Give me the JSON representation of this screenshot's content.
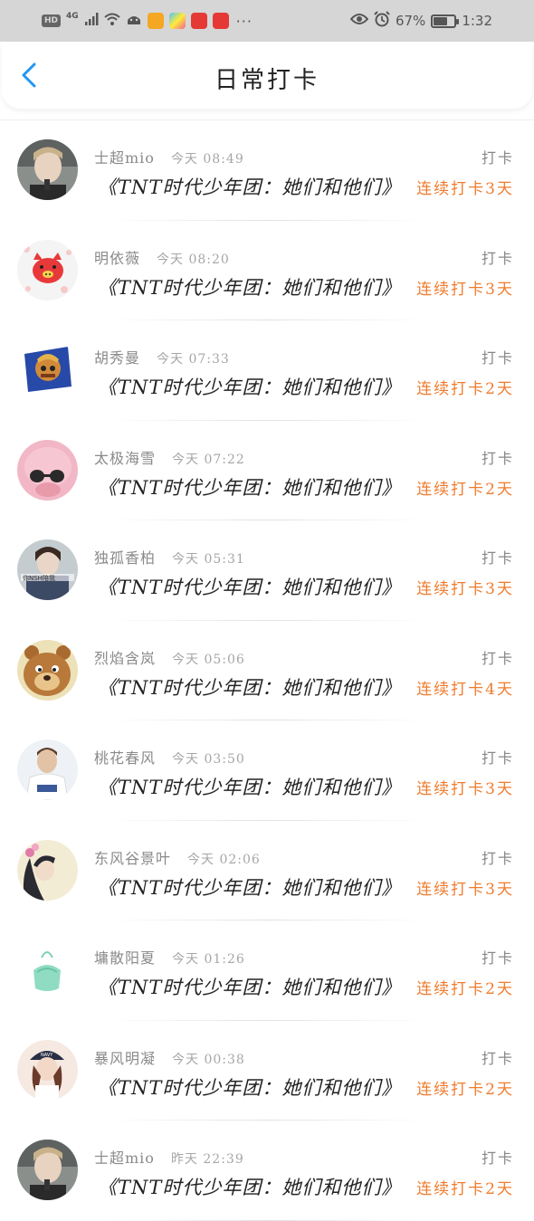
{
  "status_bar": {
    "hd": "HD",
    "network": "4G",
    "more": "···",
    "battery": "67%",
    "time": "1:32",
    "battery_level": 0.67,
    "icons": [
      "signal-icon",
      "wifi-icon",
      "android-icon",
      "video-app-icon",
      "colorful-app-icon",
      "red-app-icon",
      "red-app-icon",
      "eye-icon",
      "alarm-icon",
      "battery-icon"
    ]
  },
  "header": {
    "title": "日常打卡",
    "back_icon": "chevron-left-icon",
    "accent": "#2196f3"
  },
  "theme": {
    "streak_color": "#f07c2e"
  },
  "checkins": [
    {
      "name": "士超mio",
      "time": "今天 08:49",
      "book": "《TNT时代少年团：她们和他们》",
      "action": "打卡",
      "streak": "连续打卡3天",
      "avatar": "avatar-boy"
    },
    {
      "name": "明依薇",
      "time": "今天 08:20",
      "book": "《TNT时代少年团：她们和他们》",
      "action": "打卡",
      "streak": "连续打卡3天",
      "avatar": "avatar-pig"
    },
    {
      "name": "胡秀曼",
      "time": "今天 07:33",
      "book": "《TNT时代少年团：她们和他们》",
      "action": "打卡",
      "streak": "连续打卡2天",
      "avatar": "avatar-cartoon"
    },
    {
      "name": "太极海雪",
      "time": "今天 07:22",
      "book": "《TNT时代少年团：她们和他们》",
      "action": "打卡",
      "streak": "连续打卡2天",
      "avatar": "avatar-pink"
    },
    {
      "name": "独孤香柏",
      "time": "今天 05:31",
      "book": "《TNT时代少年团：她们和他们》",
      "action": "打卡",
      "streak": "连续打卡3天",
      "avatar": "avatar-girl"
    },
    {
      "name": "烈焰含岚",
      "time": "今天 05:06",
      "book": "《TNT时代少年团：她们和他们》",
      "action": "打卡",
      "streak": "连续打卡4天",
      "avatar": "avatar-bear"
    },
    {
      "name": "桃花春风",
      "time": "今天 03:50",
      "book": "《TNT时代少年团：她们和他们》",
      "action": "打卡",
      "streak": "连续打卡3天",
      "avatar": "avatar-man"
    },
    {
      "name": "东风谷景叶",
      "time": "今天 02:06",
      "book": "《TNT时代少年团：她们和他们》",
      "action": "打卡",
      "streak": "连续打卡3天",
      "avatar": "avatar-woman"
    },
    {
      "name": "墉散阳夏",
      "time": "今天 01:26",
      "book": "《TNT时代少年团：她们和他们》",
      "action": "打卡",
      "streak": "连续打卡2天",
      "avatar": "avatar-bag"
    },
    {
      "name": "暴风明凝",
      "time": "今天 00:38",
      "book": "《TNT时代少年团：她们和他们》",
      "action": "打卡",
      "streak": "连续打卡2天",
      "avatar": "avatar-hat-girl"
    },
    {
      "name": "士超mio",
      "time": "昨天 22:39",
      "book": "《TNT时代少年团：她们和他们》",
      "action": "打卡",
      "streak": "连续打卡2天",
      "avatar": "avatar-boy"
    }
  ]
}
